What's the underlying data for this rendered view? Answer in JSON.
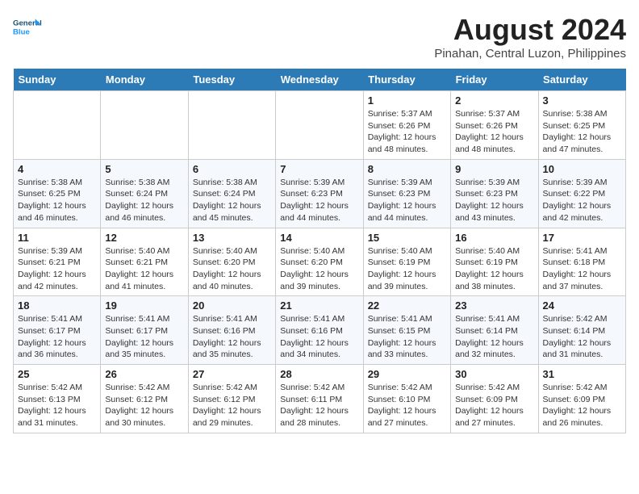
{
  "header": {
    "logo_line1": "General",
    "logo_line2": "Blue",
    "main_title": "August 2024",
    "subtitle": "Pinahan, Central Luzon, Philippines"
  },
  "days_of_week": [
    "Sunday",
    "Monday",
    "Tuesday",
    "Wednesday",
    "Thursday",
    "Friday",
    "Saturday"
  ],
  "weeks": [
    [
      {
        "date": "",
        "info": ""
      },
      {
        "date": "",
        "info": ""
      },
      {
        "date": "",
        "info": ""
      },
      {
        "date": "",
        "info": ""
      },
      {
        "date": "1",
        "info": "Sunrise: 5:37 AM\nSunset: 6:26 PM\nDaylight: 12 hours\nand 48 minutes."
      },
      {
        "date": "2",
        "info": "Sunrise: 5:37 AM\nSunset: 6:26 PM\nDaylight: 12 hours\nand 48 minutes."
      },
      {
        "date": "3",
        "info": "Sunrise: 5:38 AM\nSunset: 6:25 PM\nDaylight: 12 hours\nand 47 minutes."
      }
    ],
    [
      {
        "date": "4",
        "info": "Sunrise: 5:38 AM\nSunset: 6:25 PM\nDaylight: 12 hours\nand 46 minutes."
      },
      {
        "date": "5",
        "info": "Sunrise: 5:38 AM\nSunset: 6:24 PM\nDaylight: 12 hours\nand 46 minutes."
      },
      {
        "date": "6",
        "info": "Sunrise: 5:38 AM\nSunset: 6:24 PM\nDaylight: 12 hours\nand 45 minutes."
      },
      {
        "date": "7",
        "info": "Sunrise: 5:39 AM\nSunset: 6:23 PM\nDaylight: 12 hours\nand 44 minutes."
      },
      {
        "date": "8",
        "info": "Sunrise: 5:39 AM\nSunset: 6:23 PM\nDaylight: 12 hours\nand 44 minutes."
      },
      {
        "date": "9",
        "info": "Sunrise: 5:39 AM\nSunset: 6:23 PM\nDaylight: 12 hours\nand 43 minutes."
      },
      {
        "date": "10",
        "info": "Sunrise: 5:39 AM\nSunset: 6:22 PM\nDaylight: 12 hours\nand 42 minutes."
      }
    ],
    [
      {
        "date": "11",
        "info": "Sunrise: 5:39 AM\nSunset: 6:21 PM\nDaylight: 12 hours\nand 42 minutes."
      },
      {
        "date": "12",
        "info": "Sunrise: 5:40 AM\nSunset: 6:21 PM\nDaylight: 12 hours\nand 41 minutes."
      },
      {
        "date": "13",
        "info": "Sunrise: 5:40 AM\nSunset: 6:20 PM\nDaylight: 12 hours\nand 40 minutes."
      },
      {
        "date": "14",
        "info": "Sunrise: 5:40 AM\nSunset: 6:20 PM\nDaylight: 12 hours\nand 39 minutes."
      },
      {
        "date": "15",
        "info": "Sunrise: 5:40 AM\nSunset: 6:19 PM\nDaylight: 12 hours\nand 39 minutes."
      },
      {
        "date": "16",
        "info": "Sunrise: 5:40 AM\nSunset: 6:19 PM\nDaylight: 12 hours\nand 38 minutes."
      },
      {
        "date": "17",
        "info": "Sunrise: 5:41 AM\nSunset: 6:18 PM\nDaylight: 12 hours\nand 37 minutes."
      }
    ],
    [
      {
        "date": "18",
        "info": "Sunrise: 5:41 AM\nSunset: 6:17 PM\nDaylight: 12 hours\nand 36 minutes."
      },
      {
        "date": "19",
        "info": "Sunrise: 5:41 AM\nSunset: 6:17 PM\nDaylight: 12 hours\nand 35 minutes."
      },
      {
        "date": "20",
        "info": "Sunrise: 5:41 AM\nSunset: 6:16 PM\nDaylight: 12 hours\nand 35 minutes."
      },
      {
        "date": "21",
        "info": "Sunrise: 5:41 AM\nSunset: 6:16 PM\nDaylight: 12 hours\nand 34 minutes."
      },
      {
        "date": "22",
        "info": "Sunrise: 5:41 AM\nSunset: 6:15 PM\nDaylight: 12 hours\nand 33 minutes."
      },
      {
        "date": "23",
        "info": "Sunrise: 5:41 AM\nSunset: 6:14 PM\nDaylight: 12 hours\nand 32 minutes."
      },
      {
        "date": "24",
        "info": "Sunrise: 5:42 AM\nSunset: 6:14 PM\nDaylight: 12 hours\nand 31 minutes."
      }
    ],
    [
      {
        "date": "25",
        "info": "Sunrise: 5:42 AM\nSunset: 6:13 PM\nDaylight: 12 hours\nand 31 minutes."
      },
      {
        "date": "26",
        "info": "Sunrise: 5:42 AM\nSunset: 6:12 PM\nDaylight: 12 hours\nand 30 minutes."
      },
      {
        "date": "27",
        "info": "Sunrise: 5:42 AM\nSunset: 6:12 PM\nDaylight: 12 hours\nand 29 minutes."
      },
      {
        "date": "28",
        "info": "Sunrise: 5:42 AM\nSunset: 6:11 PM\nDaylight: 12 hours\nand 28 minutes."
      },
      {
        "date": "29",
        "info": "Sunrise: 5:42 AM\nSunset: 6:10 PM\nDaylight: 12 hours\nand 27 minutes."
      },
      {
        "date": "30",
        "info": "Sunrise: 5:42 AM\nSunset: 6:09 PM\nDaylight: 12 hours\nand 27 minutes."
      },
      {
        "date": "31",
        "info": "Sunrise: 5:42 AM\nSunset: 6:09 PM\nDaylight: 12 hours\nand 26 minutes."
      }
    ]
  ]
}
